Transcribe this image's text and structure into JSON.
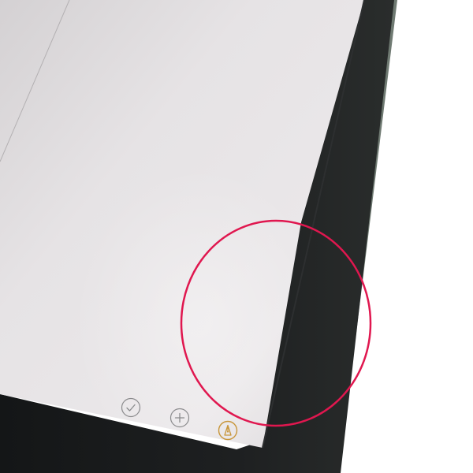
{
  "colors": {
    "screen_light": "#e9e6e8",
    "screen_mid": "#d9d6d8",
    "screen_shadow": "#c7c4c6",
    "bezel": "#1b1d1e",
    "bezel_edge": "#3a3d3c",
    "frame_edge": "#6f7a72",
    "icon_gray": "#8a8a8c",
    "icon_accent": "#c8963a",
    "highlight_circle": "#e0174f"
  },
  "toolbar": {
    "buttons": [
      {
        "id": "checklist",
        "icon": "checkmark-circle-icon"
      },
      {
        "id": "add",
        "icon": "plus-circle-icon"
      },
      {
        "id": "markup",
        "icon": "pen-tip-circle-icon"
      }
    ]
  },
  "annotation": {
    "shape": "circle",
    "purpose": "highlight"
  }
}
